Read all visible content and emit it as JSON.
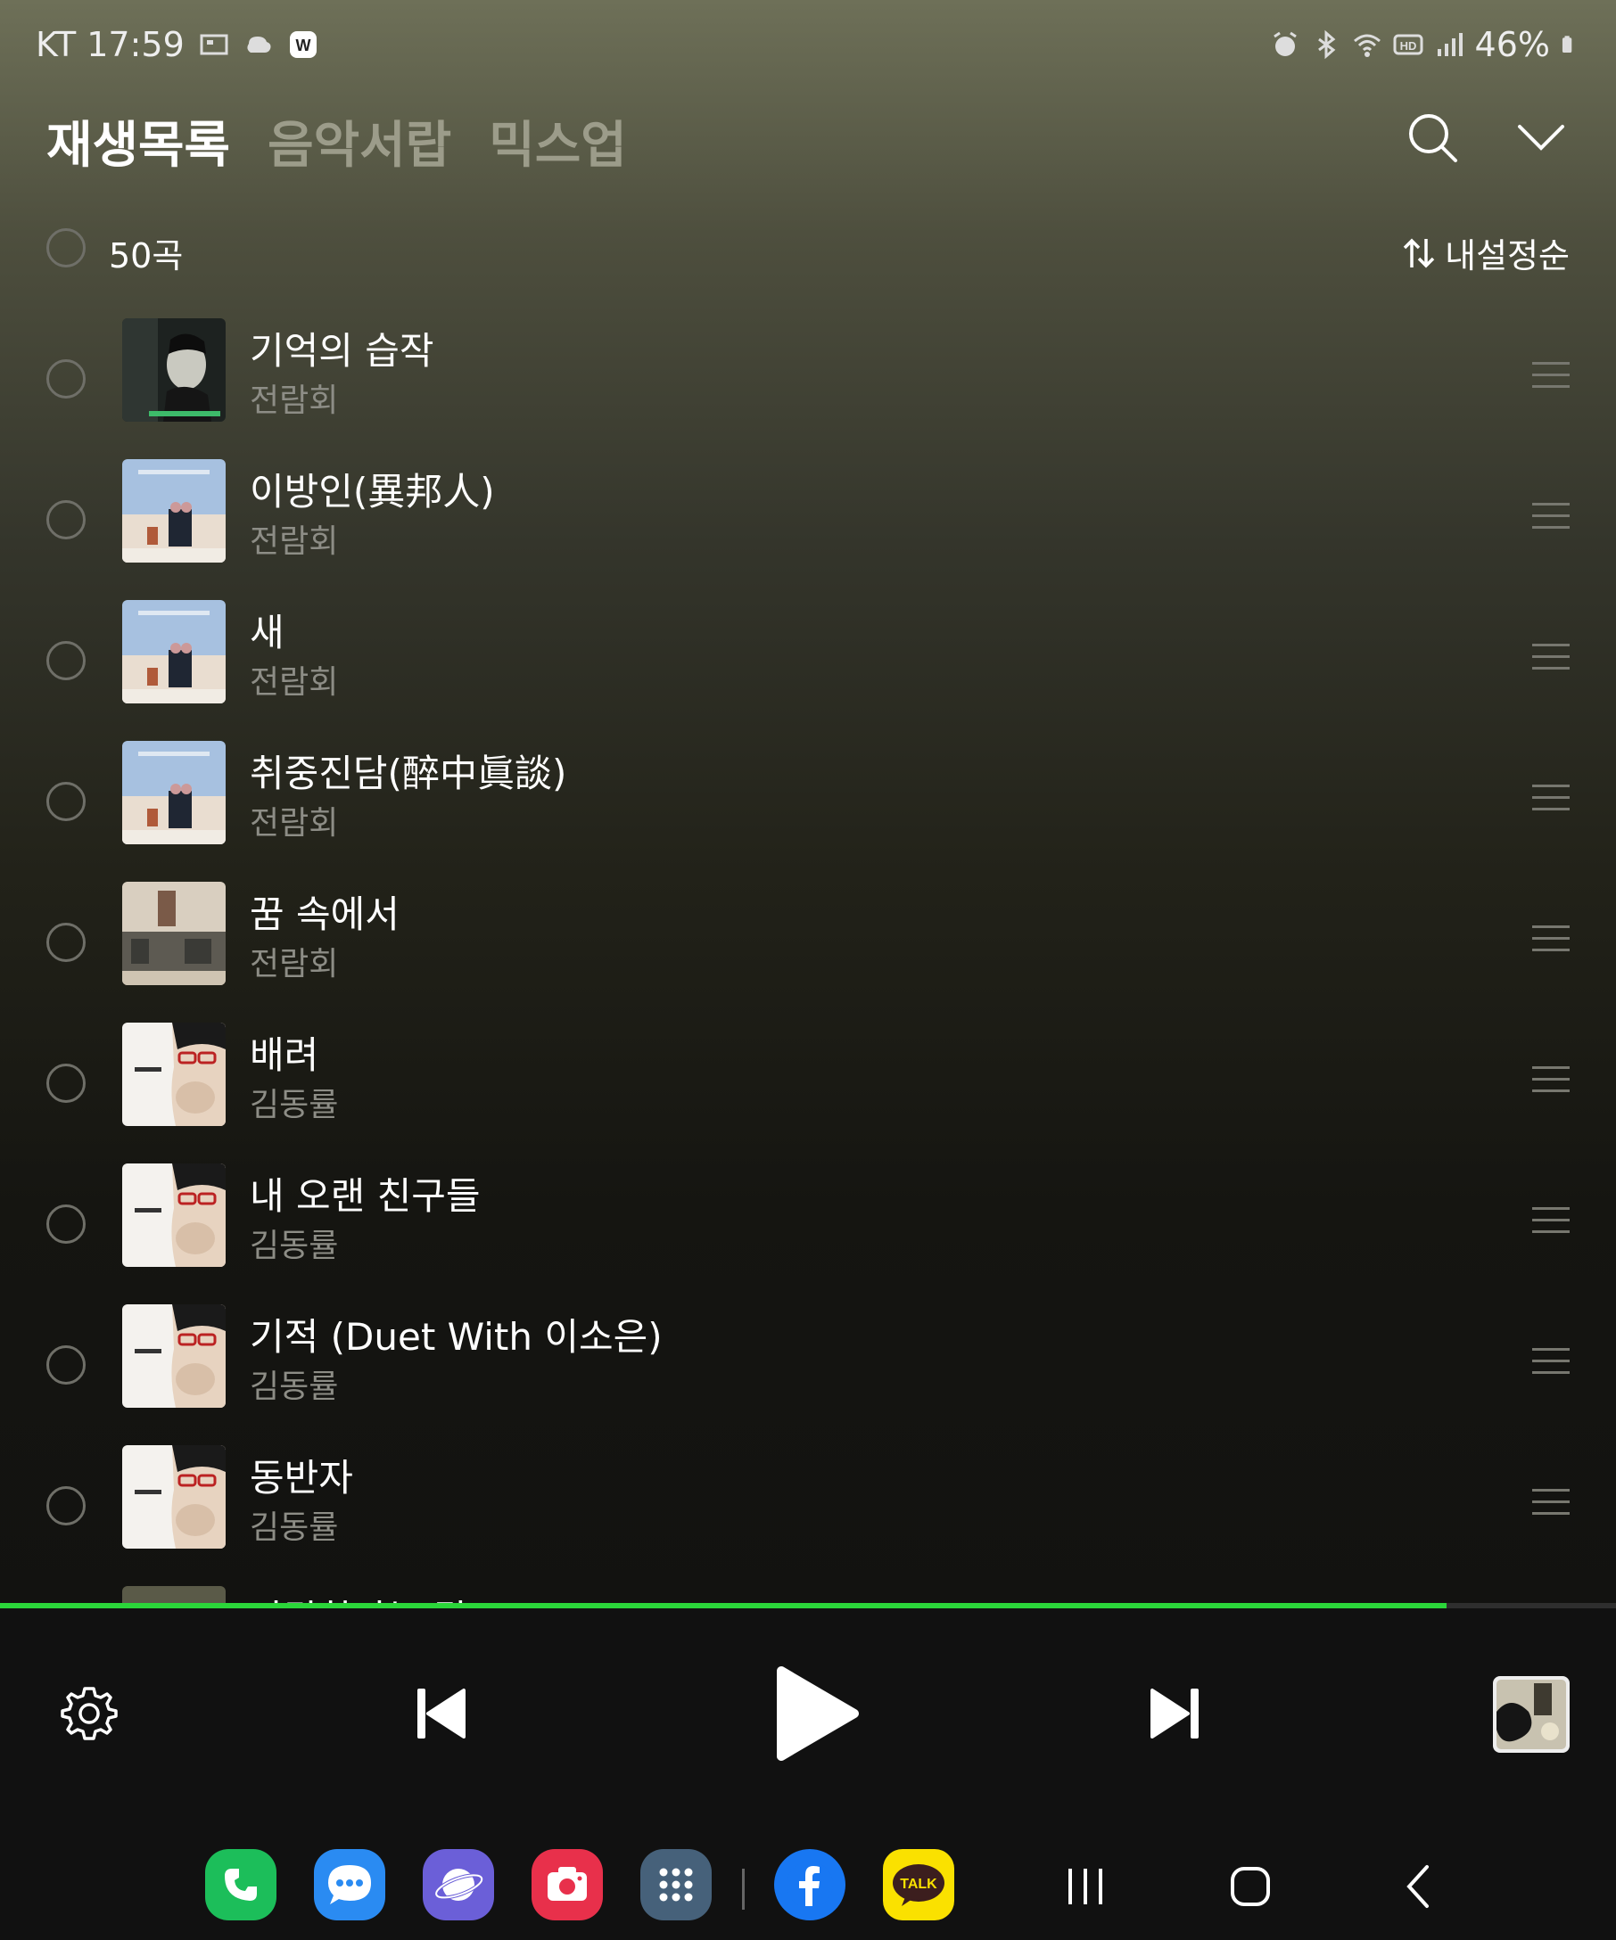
{
  "status": {
    "carrier_time": "KT 17:59",
    "battery": "46%"
  },
  "tabs": [
    {
      "label": "재생목록",
      "active": true
    },
    {
      "label": "음악서랍",
      "active": false
    },
    {
      "label": "믹스업",
      "active": false
    }
  ],
  "list_header": {
    "count": "50곡",
    "sort_label": "내설정순"
  },
  "tracks": [
    {
      "title": "기억의 습작",
      "artist": "전람회"
    },
    {
      "title": "이방인(異邦人)",
      "artist": "전람회"
    },
    {
      "title": "새",
      "artist": "전람회"
    },
    {
      "title": "취중진담(醉中眞談)",
      "artist": "전람회"
    },
    {
      "title": "꿈 속에서",
      "artist": "전람회"
    },
    {
      "title": "배려",
      "artist": "김동률"
    },
    {
      "title": "내 오랜 친구들",
      "artist": "김동률"
    },
    {
      "title": "기적 (Duet With 이소은)",
      "artist": "김동률"
    },
    {
      "title": "동반자",
      "artist": "김동률"
    },
    {
      "title": "사랑한다는 말",
      "artist": ""
    }
  ],
  "playback": {
    "progress": 0.895
  },
  "colors": {
    "accent": "#2bd63a"
  },
  "icons": {
    "search": "search-icon",
    "collapse": "chevron-down-icon",
    "sort": "sort-arrows-icon",
    "settings": "gear-icon",
    "prev": "skip-previous-icon",
    "play": "play-icon",
    "next": "skip-next-icon",
    "phone": "phone-icon",
    "messages": "messages-icon",
    "internet": "internet-icon",
    "camera": "camera-icon",
    "apps": "apps-grid-icon",
    "facebook": "facebook-icon",
    "kakaotalk": "kakaotalk-icon",
    "recents": "recents-icon",
    "home": "home-icon",
    "back": "back-icon"
  },
  "dock": {
    "kakaotalk_label": "TALK"
  }
}
